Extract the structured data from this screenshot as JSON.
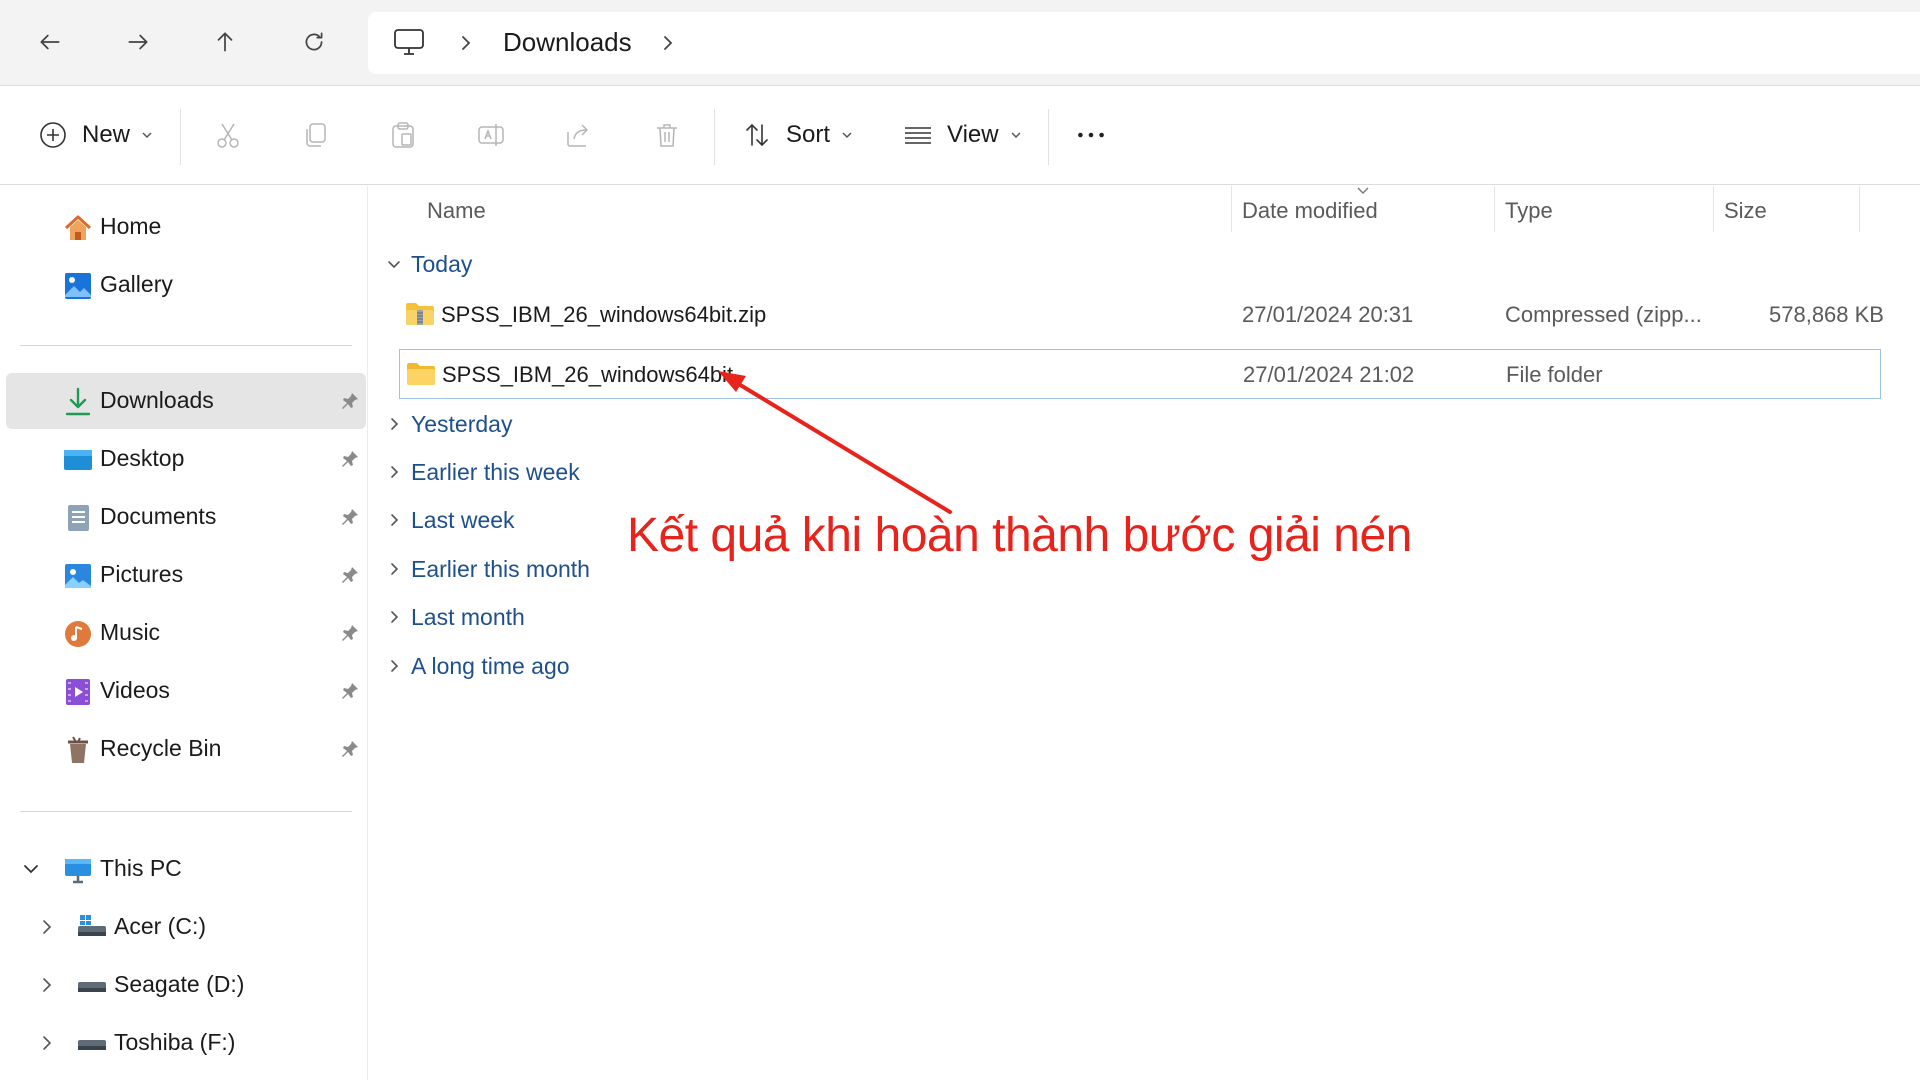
{
  "address_bar": {
    "breadcrumb": [
      "Downloads"
    ]
  },
  "command_bar": {
    "new_label": "New",
    "sort_label": "Sort",
    "view_label": "View"
  },
  "sidebar": {
    "top_items": [
      {
        "label": "Home",
        "icon": "home-icon"
      },
      {
        "label": "Gallery",
        "icon": "gallery-icon"
      }
    ],
    "quick_access": [
      {
        "label": "Downloads",
        "icon": "downloads-icon",
        "selected": true
      },
      {
        "label": "Desktop",
        "icon": "desktop-icon"
      },
      {
        "label": "Documents",
        "icon": "documents-icon"
      },
      {
        "label": "Pictures",
        "icon": "pictures-icon"
      },
      {
        "label": "Music",
        "icon": "music-icon"
      },
      {
        "label": "Videos",
        "icon": "videos-icon"
      },
      {
        "label": "Recycle Bin",
        "icon": "recycle-bin-icon"
      }
    ],
    "this_pc": {
      "label": "This PC",
      "icon": "this-pc-icon"
    },
    "drives": [
      {
        "label": "Acer (C:)",
        "icon": "drive-c-icon"
      },
      {
        "label": "Seagate (D:)",
        "icon": "drive-d-icon"
      },
      {
        "label": "Toshiba (F:)",
        "icon": "drive-f-icon"
      }
    ]
  },
  "columns": {
    "name": "Name",
    "date_modified": "Date modified",
    "type": "Type",
    "size": "Size"
  },
  "groups": {
    "today": "Today",
    "yesterday": "Yesterday",
    "earlier_this_week": "Earlier this week",
    "last_week": "Last week",
    "earlier_this_month": "Earlier this month",
    "last_month": "Last month",
    "long_time_ago": "A long time ago"
  },
  "files": [
    {
      "name": "SPSS_IBM_26_windows64bit.zip",
      "date": "27/01/2024 20:31",
      "type": "Compressed (zipp...",
      "size": "578,868 KB",
      "icon": "zip-folder-icon"
    },
    {
      "name": "SPSS_IBM_26_windows64bit",
      "date": "27/01/2024 21:02",
      "type": "File folder",
      "size": "",
      "icon": "folder-icon",
      "selected": true
    }
  ],
  "annotation": {
    "text": "Kết quả khi hoàn thành bước giải nén",
    "color": "#e8231b"
  },
  "colors": {
    "accent_text": "#1e4f8f",
    "selection_border": "#9ec1e6",
    "sidebar_selected": "#e5e5e5"
  }
}
